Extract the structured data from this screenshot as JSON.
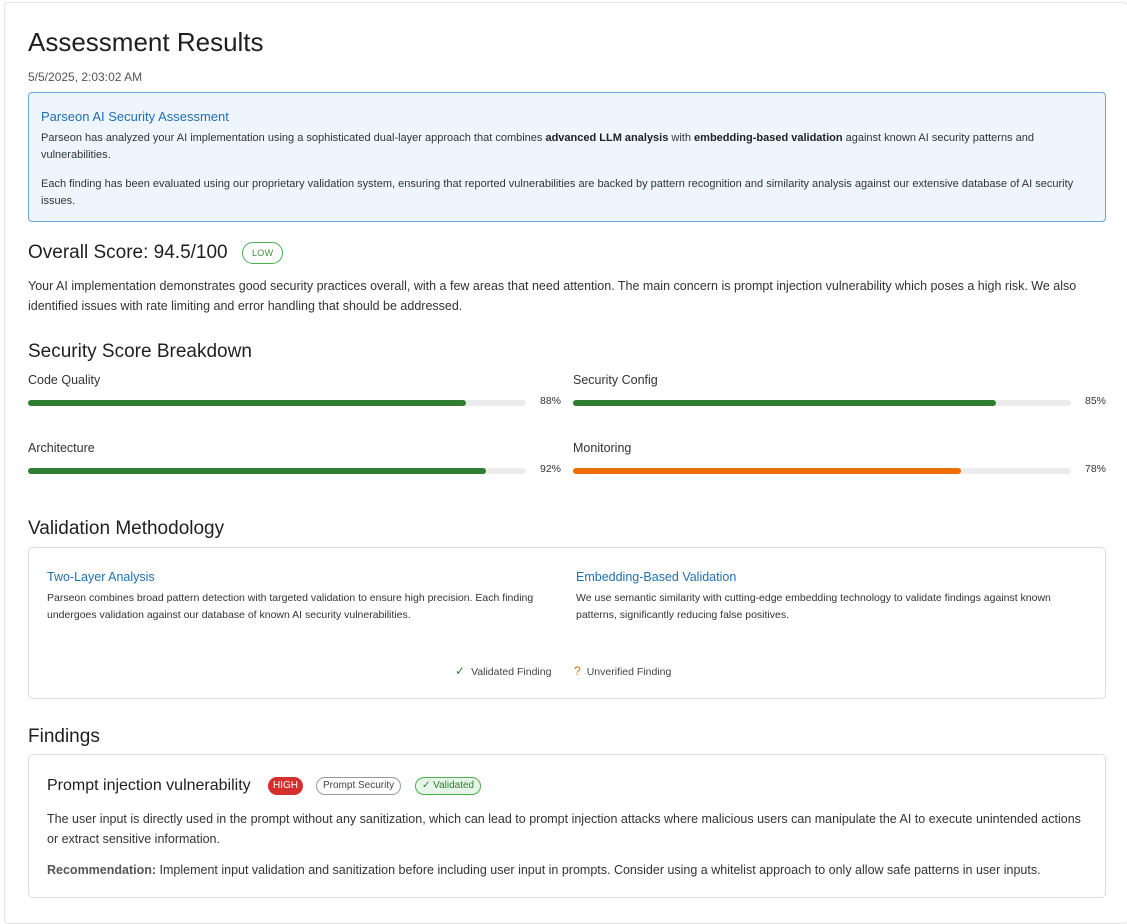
{
  "header": {
    "title": "Assessment Results",
    "timestamp": "5/5/2025, 2:03:02 AM"
  },
  "info": {
    "title": "Parseon AI Security Assessment",
    "p1_before": "Parseon has analyzed your AI implementation using a sophisticated dual-layer approach that combines ",
    "p1_bold1": "advanced LLM analysis",
    "p1_mid": " with ",
    "p1_bold2": "embedding-based validation",
    "p1_after": " against known AI security patterns and vulnerabilities.",
    "p2": "Each finding has been evaluated using our proprietary validation system, ensuring that reported vulnerabilities are backed by pattern recognition and similarity analysis against our extensive database of AI security issues."
  },
  "score": {
    "title": "Overall Score: 94.5/100",
    "badge": "LOW",
    "summary": "Your AI implementation demonstrates good security practices overall, with a few areas that need attention. The main concern is prompt injection vulnerability which poses a high risk. We also identified issues with rate limiting and error handling that should be addressed."
  },
  "breakdown": {
    "title": "Security Score Breakdown",
    "metrics": [
      {
        "label": "Code Quality",
        "value": "88%",
        "percent": 88,
        "color": "#2e7d32"
      },
      {
        "label": "Security Config",
        "value": "85%",
        "percent": 85,
        "color": "#2e7d32"
      },
      {
        "label": "Architecture",
        "value": "92%",
        "percent": 92,
        "color": "#2e7d32"
      },
      {
        "label": "Monitoring",
        "value": "78%",
        "percent": 78,
        "color": "#ef6c00"
      }
    ]
  },
  "methodology": {
    "title": "Validation Methodology",
    "col1_title": "Two-Layer Analysis",
    "col1_text": "Parseon combines broad pattern detection with targeted validation to ensure high precision. Each finding undergoes validation against our database of known AI security vulnerabilities.",
    "col2_title": "Embedding-Based Validation",
    "col2_text": "We use semantic similarity with cutting-edge embedding technology to validate findings against known patterns, significantly reducing false positives.",
    "legend_validated_icon": "✓",
    "legend_validated": "Validated Finding",
    "legend_unverified_icon": "?",
    "legend_unverified": "Unverified Finding"
  },
  "findings": {
    "title": "Findings",
    "items": [
      {
        "title": "Prompt injection vulnerability",
        "severity": "HIGH",
        "category": "Prompt Security",
        "validated": "✓ Validated",
        "description": "The user input is directly used in the prompt without any sanitization, which can lead to prompt injection attacks where malicious users can manipulate the AI to execute unintended actions or extract sensitive information.",
        "recommendation_label": "Recommendation:",
        "recommendation": " Implement input validation and sanitization before including user input in prompts. Consider using a whitelist approach to only allow safe patterns in user inputs."
      }
    ]
  }
}
